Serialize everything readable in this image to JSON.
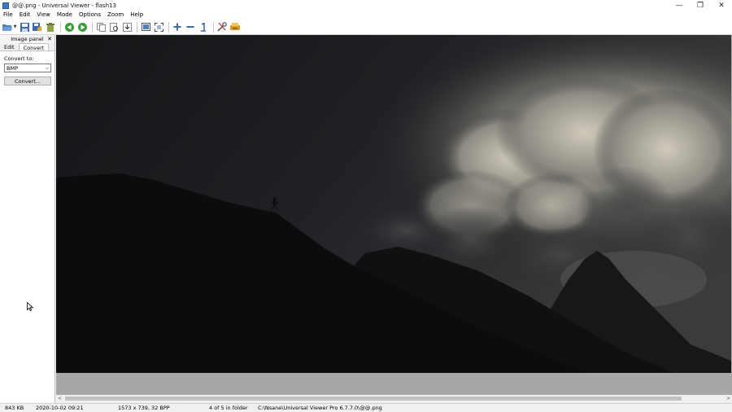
{
  "window": {
    "title": "@@.png - Universal Viewer - flash13",
    "minimize": "—",
    "restore": "❐",
    "close": "✕"
  },
  "menu": [
    "File",
    "Edit",
    "View",
    "Mode",
    "Options",
    "Zoom",
    "Help"
  ],
  "toolbar": {
    "icons": [
      "open-icon",
      "save-icon",
      "save-as-icon",
      "delete-icon",
      "previous-icon",
      "next-icon",
      "copy-icon",
      "print-preview-icon",
      "paste-icon",
      "fit-window-icon",
      "fullscreen-icon",
      "zoom-in-icon",
      "zoom-out-icon",
      "original-size-icon",
      "settings-icon",
      "transform-icon"
    ],
    "dropdown_caret": "▼"
  },
  "side_panel": {
    "title": "Image panel",
    "close": "✕",
    "tabs": [
      "Edit",
      "Convert"
    ],
    "active_tab": "Convert",
    "convert_label": "Convert to:",
    "format_selected": "BMP",
    "select_caret": "⌵",
    "convert_button": "Convert..."
  },
  "scrollbar": {
    "left": "<",
    "right": ">"
  },
  "status": {
    "file_size": "843 KB",
    "date": "2020-10-02 09:21",
    "image_info": "1573 x 739, 32 BPP",
    "position": "4 of 5 in folder",
    "path": "C:\\Nsane\\Universal Viewer Pro 6.7.7.0\\@@.png"
  },
  "colors": {
    "accent": "#3b78c4",
    "viewer_background": "#a7a7a7",
    "sky_dark": "#1a1b1d",
    "cloud_light": "#e8e4d6",
    "mountain": "#0e0e10"
  }
}
